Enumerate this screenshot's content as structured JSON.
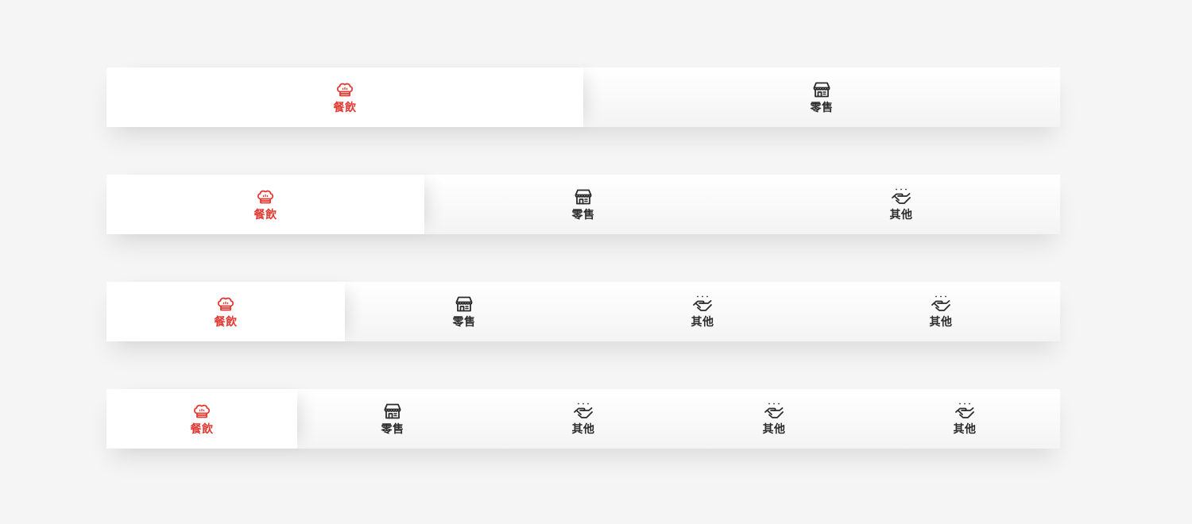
{
  "colors": {
    "background": "#f5f5f5",
    "active": "#e23a32",
    "inactive": "#2b2b2b",
    "bar": "#ffffff"
  },
  "tabbars": [
    {
      "tabs": [
        {
          "label": "餐飲",
          "icon": "chef-hat-icon",
          "active": true
        },
        {
          "label": "零售",
          "icon": "store-icon",
          "active": false
        }
      ]
    },
    {
      "tabs": [
        {
          "label": "餐飲",
          "icon": "chef-hat-icon",
          "active": true
        },
        {
          "label": "零售",
          "icon": "store-icon",
          "active": false
        },
        {
          "label": "其他",
          "icon": "hand-service-icon",
          "active": false
        }
      ]
    },
    {
      "tabs": [
        {
          "label": "餐飲",
          "icon": "chef-hat-icon",
          "active": true
        },
        {
          "label": "零售",
          "icon": "store-icon",
          "active": false
        },
        {
          "label": "其他",
          "icon": "hand-service-icon",
          "active": false
        },
        {
          "label": "其他",
          "icon": "hand-service-icon",
          "active": false
        }
      ]
    },
    {
      "tabs": [
        {
          "label": "餐飲",
          "icon": "chef-hat-icon",
          "active": true
        },
        {
          "label": "零售",
          "icon": "store-icon",
          "active": false
        },
        {
          "label": "其他",
          "icon": "hand-service-icon",
          "active": false
        },
        {
          "label": "其他",
          "icon": "hand-service-icon",
          "active": false
        },
        {
          "label": "其他",
          "icon": "hand-service-icon",
          "active": false
        }
      ]
    }
  ]
}
